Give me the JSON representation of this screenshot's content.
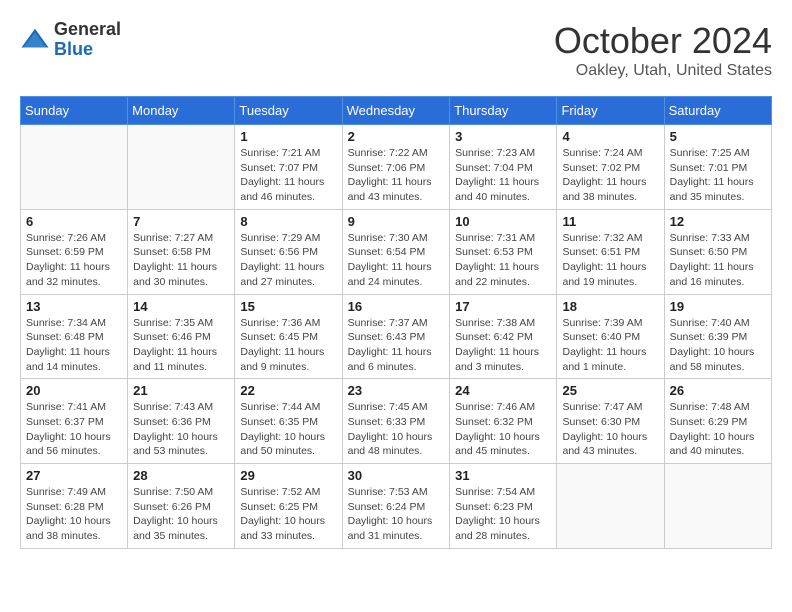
{
  "header": {
    "logo_general": "General",
    "logo_blue": "Blue",
    "month_title": "October 2024",
    "location": "Oakley, Utah, United States"
  },
  "days_of_week": [
    "Sunday",
    "Monday",
    "Tuesday",
    "Wednesday",
    "Thursday",
    "Friday",
    "Saturday"
  ],
  "weeks": [
    [
      {
        "day": "",
        "info": ""
      },
      {
        "day": "",
        "info": ""
      },
      {
        "day": "1",
        "info": "Sunrise: 7:21 AM\nSunset: 7:07 PM\nDaylight: 11 hours and 46 minutes."
      },
      {
        "day": "2",
        "info": "Sunrise: 7:22 AM\nSunset: 7:06 PM\nDaylight: 11 hours and 43 minutes."
      },
      {
        "day": "3",
        "info": "Sunrise: 7:23 AM\nSunset: 7:04 PM\nDaylight: 11 hours and 40 minutes."
      },
      {
        "day": "4",
        "info": "Sunrise: 7:24 AM\nSunset: 7:02 PM\nDaylight: 11 hours and 38 minutes."
      },
      {
        "day": "5",
        "info": "Sunrise: 7:25 AM\nSunset: 7:01 PM\nDaylight: 11 hours and 35 minutes."
      }
    ],
    [
      {
        "day": "6",
        "info": "Sunrise: 7:26 AM\nSunset: 6:59 PM\nDaylight: 11 hours and 32 minutes."
      },
      {
        "day": "7",
        "info": "Sunrise: 7:27 AM\nSunset: 6:58 PM\nDaylight: 11 hours and 30 minutes."
      },
      {
        "day": "8",
        "info": "Sunrise: 7:29 AM\nSunset: 6:56 PM\nDaylight: 11 hours and 27 minutes."
      },
      {
        "day": "9",
        "info": "Sunrise: 7:30 AM\nSunset: 6:54 PM\nDaylight: 11 hours and 24 minutes."
      },
      {
        "day": "10",
        "info": "Sunrise: 7:31 AM\nSunset: 6:53 PM\nDaylight: 11 hours and 22 minutes."
      },
      {
        "day": "11",
        "info": "Sunrise: 7:32 AM\nSunset: 6:51 PM\nDaylight: 11 hours and 19 minutes."
      },
      {
        "day": "12",
        "info": "Sunrise: 7:33 AM\nSunset: 6:50 PM\nDaylight: 11 hours and 16 minutes."
      }
    ],
    [
      {
        "day": "13",
        "info": "Sunrise: 7:34 AM\nSunset: 6:48 PM\nDaylight: 11 hours and 14 minutes."
      },
      {
        "day": "14",
        "info": "Sunrise: 7:35 AM\nSunset: 6:46 PM\nDaylight: 11 hours and 11 minutes."
      },
      {
        "day": "15",
        "info": "Sunrise: 7:36 AM\nSunset: 6:45 PM\nDaylight: 11 hours and 9 minutes."
      },
      {
        "day": "16",
        "info": "Sunrise: 7:37 AM\nSunset: 6:43 PM\nDaylight: 11 hours and 6 minutes."
      },
      {
        "day": "17",
        "info": "Sunrise: 7:38 AM\nSunset: 6:42 PM\nDaylight: 11 hours and 3 minutes."
      },
      {
        "day": "18",
        "info": "Sunrise: 7:39 AM\nSunset: 6:40 PM\nDaylight: 11 hours and 1 minute."
      },
      {
        "day": "19",
        "info": "Sunrise: 7:40 AM\nSunset: 6:39 PM\nDaylight: 10 hours and 58 minutes."
      }
    ],
    [
      {
        "day": "20",
        "info": "Sunrise: 7:41 AM\nSunset: 6:37 PM\nDaylight: 10 hours and 56 minutes."
      },
      {
        "day": "21",
        "info": "Sunrise: 7:43 AM\nSunset: 6:36 PM\nDaylight: 10 hours and 53 minutes."
      },
      {
        "day": "22",
        "info": "Sunrise: 7:44 AM\nSunset: 6:35 PM\nDaylight: 10 hours and 50 minutes."
      },
      {
        "day": "23",
        "info": "Sunrise: 7:45 AM\nSunset: 6:33 PM\nDaylight: 10 hours and 48 minutes."
      },
      {
        "day": "24",
        "info": "Sunrise: 7:46 AM\nSunset: 6:32 PM\nDaylight: 10 hours and 45 minutes."
      },
      {
        "day": "25",
        "info": "Sunrise: 7:47 AM\nSunset: 6:30 PM\nDaylight: 10 hours and 43 minutes."
      },
      {
        "day": "26",
        "info": "Sunrise: 7:48 AM\nSunset: 6:29 PM\nDaylight: 10 hours and 40 minutes."
      }
    ],
    [
      {
        "day": "27",
        "info": "Sunrise: 7:49 AM\nSunset: 6:28 PM\nDaylight: 10 hours and 38 minutes."
      },
      {
        "day": "28",
        "info": "Sunrise: 7:50 AM\nSunset: 6:26 PM\nDaylight: 10 hours and 35 minutes."
      },
      {
        "day": "29",
        "info": "Sunrise: 7:52 AM\nSunset: 6:25 PM\nDaylight: 10 hours and 33 minutes."
      },
      {
        "day": "30",
        "info": "Sunrise: 7:53 AM\nSunset: 6:24 PM\nDaylight: 10 hours and 31 minutes."
      },
      {
        "day": "31",
        "info": "Sunrise: 7:54 AM\nSunset: 6:23 PM\nDaylight: 10 hours and 28 minutes."
      },
      {
        "day": "",
        "info": ""
      },
      {
        "day": "",
        "info": ""
      }
    ]
  ]
}
